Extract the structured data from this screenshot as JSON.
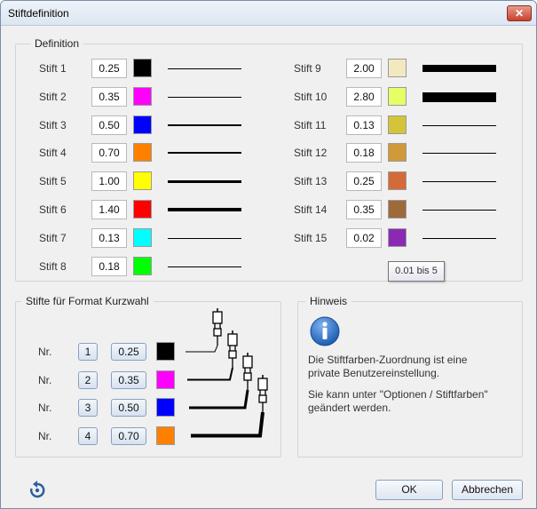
{
  "window": {
    "title": "Stiftdefinition",
    "close_glyph": "✕"
  },
  "definition": {
    "legend": "Definition",
    "pens": [
      {
        "label": "Stift 1",
        "value": "0.25",
        "color": "#000000",
        "weight": 1
      },
      {
        "label": "Stift 2",
        "value": "0.35",
        "color": "#ff00ff",
        "weight": 1
      },
      {
        "label": "Stift 3",
        "value": "0.50",
        "color": "#0000ff",
        "weight": 2
      },
      {
        "label": "Stift 4",
        "value": "0.70",
        "color": "#ff8000",
        "weight": 2
      },
      {
        "label": "Stift 5",
        "value": "1.00",
        "color": "#ffff00",
        "weight": 3
      },
      {
        "label": "Stift 6",
        "value": "1.40",
        "color": "#ff0000",
        "weight": 4
      },
      {
        "label": "Stift 7",
        "value": "0.13",
        "color": "#00ffff",
        "weight": 1
      },
      {
        "label": "Stift 8",
        "value": "0.18",
        "color": "#00ff00",
        "weight": 1
      },
      {
        "label": "Stift 9",
        "value": "2.00",
        "color": "#f2e9c0",
        "weight": 8
      },
      {
        "label": "Stift 10",
        "value": "2.80",
        "color": "#e6ff66",
        "weight": 11
      },
      {
        "label": "Stift 11",
        "value": "0.13",
        "color": "#d4c43a",
        "weight": 1
      },
      {
        "label": "Stift 12",
        "value": "0.18",
        "color": "#d09a3a",
        "weight": 1
      },
      {
        "label": "Stift 13",
        "value": "0.25",
        "color": "#d4693a",
        "weight": 1
      },
      {
        "label": "Stift 14",
        "value": "0.35",
        "color": "#9e6a3a",
        "weight": 1
      },
      {
        "label": "Stift 15",
        "value": "0.02",
        "color": "#8a2ab4",
        "weight": 1
      }
    ],
    "tooltip": "0.01 bis 5"
  },
  "shortcut": {
    "legend": "Stifte für Format Kurzwahl",
    "rows": [
      {
        "nr_label": "Nr.",
        "number": "1",
        "value": "0.25",
        "color": "#000000",
        "weight": 1
      },
      {
        "nr_label": "Nr.",
        "number": "2",
        "value": "0.35",
        "color": "#ff00ff",
        "weight": 2
      },
      {
        "nr_label": "Nr.",
        "number": "3",
        "value": "0.50",
        "color": "#0000ff",
        "weight": 3
      },
      {
        "nr_label": "Nr.",
        "number": "4",
        "value": "0.70",
        "color": "#ff8000",
        "weight": 4
      }
    ]
  },
  "hint": {
    "legend": "Hinweis",
    "icon": "info-icon",
    "line1a": "Die Stiftfarben-Zuordnung ist eine",
    "line1b": "private Benutzereinstellung.",
    "line2a": "Sie kann unter \"Optionen / Stiftfarben\"",
    "line2b": "geändert werden."
  },
  "footer": {
    "ok_label": "OK",
    "cancel_label": "Abbrechen",
    "reset_icon": "undo-icon"
  }
}
